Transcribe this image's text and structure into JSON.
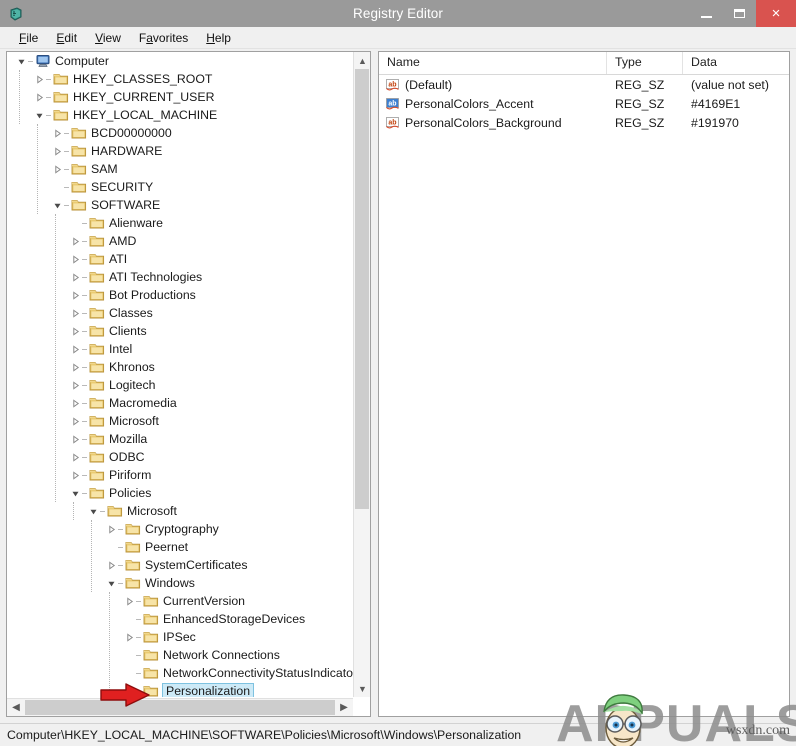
{
  "window": {
    "title": "Registry Editor",
    "app_icon": "registry-editor-icon",
    "controls": {
      "minimize": "minimize-button",
      "maximize": "maximize-button",
      "close": "×"
    }
  },
  "menubar": {
    "items": [
      {
        "label": "File",
        "accel": "F"
      },
      {
        "label": "Edit",
        "accel": "E"
      },
      {
        "label": "View",
        "accel": "V"
      },
      {
        "label": "Favorites",
        "accel": "a"
      },
      {
        "label": "Help",
        "accel": "H"
      }
    ]
  },
  "tree": {
    "nodes": [
      {
        "label": "Computer",
        "depth": 0,
        "state": "expanded",
        "icon": "computer-icon"
      },
      {
        "label": "HKEY_CLASSES_ROOT",
        "depth": 1,
        "state": "collapsed",
        "icon": "folder-icon"
      },
      {
        "label": "HKEY_CURRENT_USER",
        "depth": 1,
        "state": "collapsed",
        "icon": "folder-icon"
      },
      {
        "label": "HKEY_LOCAL_MACHINE",
        "depth": 1,
        "state": "expanded",
        "icon": "folder-icon"
      },
      {
        "label": "BCD00000000",
        "depth": 2,
        "state": "collapsed",
        "icon": "folder-icon"
      },
      {
        "label": "HARDWARE",
        "depth": 2,
        "state": "collapsed",
        "icon": "folder-icon"
      },
      {
        "label": "SAM",
        "depth": 2,
        "state": "collapsed",
        "icon": "folder-icon"
      },
      {
        "label": "SECURITY",
        "depth": 2,
        "state": "leaf",
        "icon": "folder-icon"
      },
      {
        "label": "SOFTWARE",
        "depth": 2,
        "state": "expanded",
        "icon": "folder-icon"
      },
      {
        "label": "Alienware",
        "depth": 3,
        "state": "leaf",
        "icon": "folder-icon"
      },
      {
        "label": "AMD",
        "depth": 3,
        "state": "collapsed",
        "icon": "folder-icon"
      },
      {
        "label": "ATI",
        "depth": 3,
        "state": "collapsed",
        "icon": "folder-icon"
      },
      {
        "label": "ATI Technologies",
        "depth": 3,
        "state": "collapsed",
        "icon": "folder-icon"
      },
      {
        "label": "Bot Productions",
        "depth": 3,
        "state": "collapsed",
        "icon": "folder-icon"
      },
      {
        "label": "Classes",
        "depth": 3,
        "state": "collapsed",
        "icon": "folder-icon"
      },
      {
        "label": "Clients",
        "depth": 3,
        "state": "collapsed",
        "icon": "folder-icon"
      },
      {
        "label": "Intel",
        "depth": 3,
        "state": "collapsed",
        "icon": "folder-icon"
      },
      {
        "label": "Khronos",
        "depth": 3,
        "state": "collapsed",
        "icon": "folder-icon"
      },
      {
        "label": "Logitech",
        "depth": 3,
        "state": "collapsed",
        "icon": "folder-icon"
      },
      {
        "label": "Macromedia",
        "depth": 3,
        "state": "collapsed",
        "icon": "folder-icon"
      },
      {
        "label": "Microsoft",
        "depth": 3,
        "state": "collapsed",
        "icon": "folder-icon"
      },
      {
        "label": "Mozilla",
        "depth": 3,
        "state": "collapsed",
        "icon": "folder-icon"
      },
      {
        "label": "ODBC",
        "depth": 3,
        "state": "collapsed",
        "icon": "folder-icon"
      },
      {
        "label": "Piriform",
        "depth": 3,
        "state": "collapsed",
        "icon": "folder-icon"
      },
      {
        "label": "Policies",
        "depth": 3,
        "state": "expanded",
        "icon": "folder-icon"
      },
      {
        "label": "Microsoft",
        "depth": 4,
        "state": "expanded",
        "icon": "folder-icon"
      },
      {
        "label": "Cryptography",
        "depth": 5,
        "state": "collapsed",
        "icon": "folder-icon"
      },
      {
        "label": "Peernet",
        "depth": 5,
        "state": "leaf",
        "icon": "folder-icon"
      },
      {
        "label": "SystemCertificates",
        "depth": 5,
        "state": "collapsed",
        "icon": "folder-icon"
      },
      {
        "label": "Windows",
        "depth": 5,
        "state": "expanded",
        "icon": "folder-icon"
      },
      {
        "label": "CurrentVersion",
        "depth": 6,
        "state": "collapsed",
        "icon": "folder-icon"
      },
      {
        "label": "EnhancedStorageDevices",
        "depth": 6,
        "state": "leaf",
        "icon": "folder-icon"
      },
      {
        "label": "IPSec",
        "depth": 6,
        "state": "collapsed",
        "icon": "folder-icon"
      },
      {
        "label": "Network Connections",
        "depth": 6,
        "state": "leaf",
        "icon": "folder-icon"
      },
      {
        "label": "NetworkConnectivityStatusIndicator",
        "depth": 6,
        "state": "leaf",
        "icon": "folder-icon"
      },
      {
        "label": "Personalization",
        "depth": 6,
        "state": "leaf",
        "icon": "folder-icon",
        "selected": true
      }
    ]
  },
  "values": {
    "columns": [
      "Name",
      "Type",
      "Data"
    ],
    "rows": [
      {
        "name": "(Default)",
        "type": "REG_SZ",
        "data": "(value not set)",
        "icon": "string-value-icon",
        "selected": false
      },
      {
        "name": "PersonalColors_Accent",
        "type": "REG_SZ",
        "data": "#4169E1",
        "icon": "string-value-icon",
        "selected": true
      },
      {
        "name": "PersonalColors_Background",
        "type": "REG_SZ",
        "data": "#191970",
        "icon": "string-value-icon",
        "selected": false
      }
    ]
  },
  "statusbar": {
    "path": "Computer\\HKEY_LOCAL_MACHINE\\SOFTWARE\\Policies\\Microsoft\\Windows\\Personalization"
  },
  "annotation": {
    "arrow": "red-pointer-arrow",
    "arrow_color": "#e02020"
  },
  "watermark": {
    "brand": "APPUALS",
    "url": "wsxdn.com",
    "mascot": "appuals-mascot-icon"
  },
  "colors": {
    "titlebar": "#9a9a9a",
    "close_button": "#d9534f",
    "selection": "#cdeaf7",
    "selection_border": "#7ec2e0",
    "accent_value": "#4169E1",
    "background_value": "#191970"
  },
  "scrollbars": {
    "tree_vertical": "tree-vertical-scrollbar",
    "tree_horizontal": "tree-horizontal-scrollbar"
  }
}
